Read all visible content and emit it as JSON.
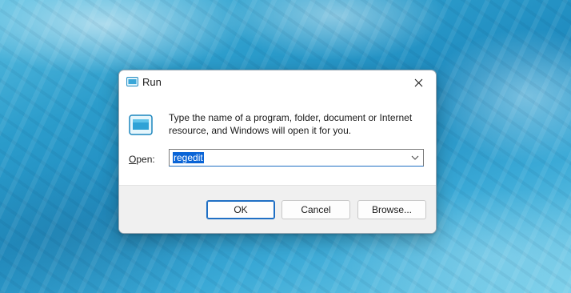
{
  "window": {
    "title": "Run",
    "icon": "run-app-icon",
    "close_icon": "close-icon"
  },
  "prompt": {
    "description": "Type the name of a program, folder, document or Internet resource, and Windows will open it for you.",
    "icon": "run-app-icon"
  },
  "open_field": {
    "label_accel": "O",
    "label_rest": "pen:",
    "value": "regedit",
    "dropdown_icon": "chevron-down-icon"
  },
  "buttons": {
    "ok": "OK",
    "cancel": "Cancel",
    "browse": "Browse..."
  },
  "colors": {
    "accent": "#0a64d6",
    "dialog_bg": "#ffffff",
    "footer_bg": "#f0f0f0"
  }
}
